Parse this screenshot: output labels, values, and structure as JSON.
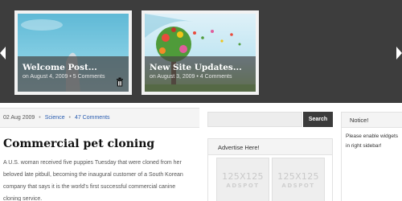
{
  "slider": {
    "slides": [
      {
        "title": "Welcome Post...",
        "meta": "on August 4, 2009 • 5 Comments"
      },
      {
        "title": "New Site Updates...",
        "meta": "on August 3, 2009 • 4 Comments"
      }
    ]
  },
  "post": {
    "date": "02 Aug 2009",
    "category": "Science",
    "comments": "47 Comments",
    "title": "Commercial pet cloning",
    "body": "A U.S. woman received five puppies Tuesday that were cloned from her beloved late pitbull, becoming the inaugural customer of a South Korean company that says it is the world's first successful commercial canine cloning service."
  },
  "search": {
    "button_label": "Search",
    "value": ""
  },
  "advertise": {
    "title": "Advertise Here!",
    "spots": [
      {
        "size": "125X125",
        "label": "ADSPOT"
      },
      {
        "size": "125X125",
        "label": "ADSPOT"
      }
    ]
  },
  "notice": {
    "title": "Notice!",
    "text": "Please enable widgets in right sidebar!"
  }
}
